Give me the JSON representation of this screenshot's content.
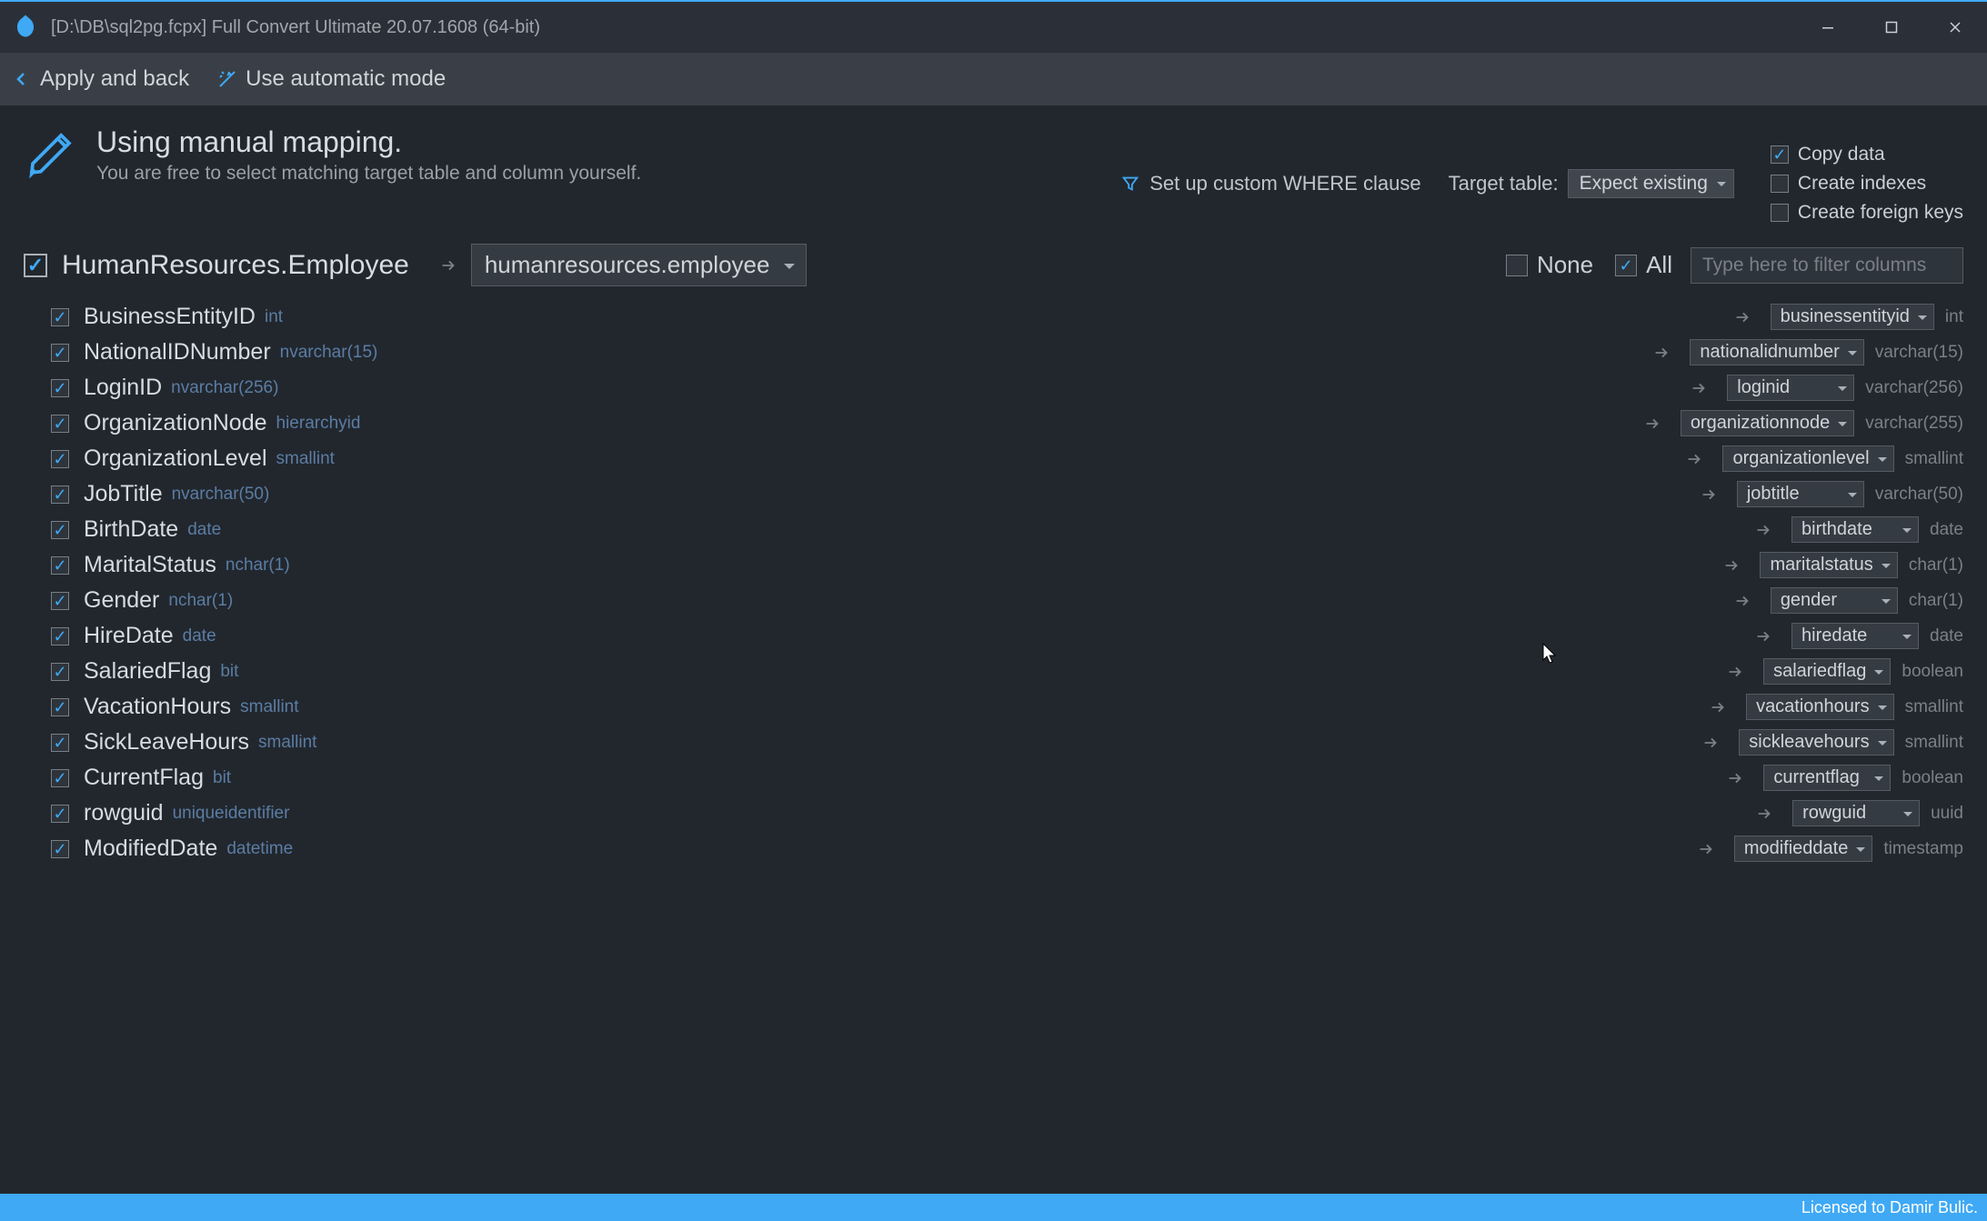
{
  "title": "[D:\\DB\\sql2pg.fcpx] Full Convert Ultimate 20.07.1608 (64-bit)",
  "toolbar": {
    "apply_back": "Apply and back",
    "auto_mode": "Use automatic mode"
  },
  "header": {
    "heading": "Using manual mapping.",
    "sub": "You are free to select matching target table and column yourself.",
    "where": "Set up custom WHERE clause",
    "target_label": "Target table:",
    "target_value": "Expect existing",
    "opts": {
      "copy_data": {
        "label": "Copy data",
        "checked": true
      },
      "create_indexes": {
        "label": "Create indexes",
        "checked": false
      },
      "create_fk": {
        "label": "Create foreign keys",
        "checked": false
      }
    }
  },
  "mapping": {
    "source_table": "HumanResources.Employee",
    "target_table": "humanresources.employee",
    "none": {
      "label": "None",
      "checked": false
    },
    "all": {
      "label": "All",
      "checked": true
    },
    "filter_placeholder": "Type here to filter columns"
  },
  "columns": [
    {
      "src": "BusinessEntityID",
      "src_type": "int",
      "tgt": "businessentityid",
      "tgt_type": "int"
    },
    {
      "src": "NationalIDNumber",
      "src_type": "nvarchar(15)",
      "tgt": "nationalidnumber",
      "tgt_type": "varchar(15)"
    },
    {
      "src": "LoginID",
      "src_type": "nvarchar(256)",
      "tgt": "loginid",
      "tgt_type": "varchar(256)"
    },
    {
      "src": "OrganizationNode",
      "src_type": "hierarchyid",
      "tgt": "organizationnode",
      "tgt_type": "varchar(255)"
    },
    {
      "src": "OrganizationLevel",
      "src_type": "smallint",
      "tgt": "organizationlevel",
      "tgt_type": "smallint"
    },
    {
      "src": "JobTitle",
      "src_type": "nvarchar(50)",
      "tgt": "jobtitle",
      "tgt_type": "varchar(50)"
    },
    {
      "src": "BirthDate",
      "src_type": "date",
      "tgt": "birthdate",
      "tgt_type": "date"
    },
    {
      "src": "MaritalStatus",
      "src_type": "nchar(1)",
      "tgt": "maritalstatus",
      "tgt_type": "char(1)"
    },
    {
      "src": "Gender",
      "src_type": "nchar(1)",
      "tgt": "gender",
      "tgt_type": "char(1)"
    },
    {
      "src": "HireDate",
      "src_type": "date",
      "tgt": "hiredate",
      "tgt_type": "date"
    },
    {
      "src": "SalariedFlag",
      "src_type": "bit",
      "tgt": "salariedflag",
      "tgt_type": "boolean"
    },
    {
      "src": "VacationHours",
      "src_type": "smallint",
      "tgt": "vacationhours",
      "tgt_type": "smallint"
    },
    {
      "src": "SickLeaveHours",
      "src_type": "smallint",
      "tgt": "sickleavehours",
      "tgt_type": "smallint"
    },
    {
      "src": "CurrentFlag",
      "src_type": "bit",
      "tgt": "currentflag",
      "tgt_type": "boolean"
    },
    {
      "src": "rowguid",
      "src_type": "uniqueidentifier",
      "tgt": "rowguid",
      "tgt_type": "uuid"
    },
    {
      "src": "ModifiedDate",
      "src_type": "datetime",
      "tgt": "modifieddate",
      "tgt_type": "timestamp"
    }
  ],
  "status": "Licensed to Damir Bulic."
}
